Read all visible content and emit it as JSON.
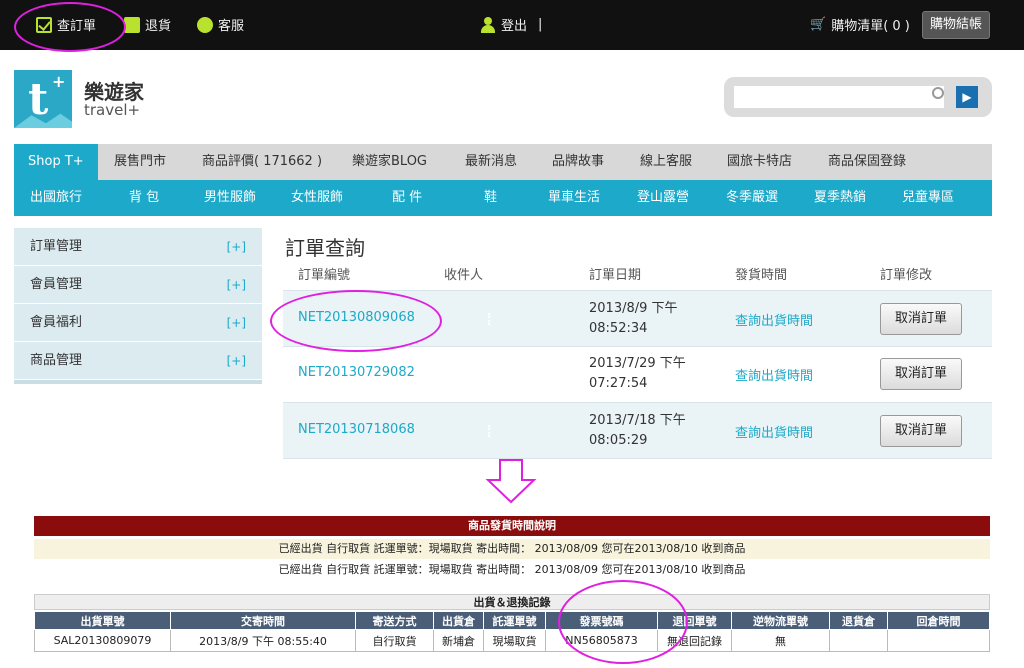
{
  "topbar": {
    "order_query": "查訂單",
    "return": "退貨",
    "service": "客服",
    "logout": "登出",
    "separator": "|",
    "cart": "購物清單( 0 )",
    "checkout": "購物結帳"
  },
  "brand": {
    "logo_letter": "t",
    "logo_plus": "+",
    "name_cn": "樂遊家",
    "name_en": "travel+"
  },
  "search": {
    "placeholder": "",
    "button": "▶"
  },
  "nav_primary": [
    "Shop T+",
    "展售門市",
    "商品評價( 171662 )",
    "樂遊家BLOG",
    "最新消息",
    "品牌故事",
    "線上客服",
    "國旅卡特店",
    "商品保固登錄"
  ],
  "nav_secondary": [
    "出國旅行",
    "背 包",
    "男性服飾",
    "女性服飾",
    "配 件",
    "鞋",
    "單車生活",
    "登山露營",
    "冬季嚴選",
    "夏季熱銷",
    "兒童專區"
  ],
  "sidebar": {
    "items": [
      {
        "label": "訂單管理",
        "toggle": "[+]"
      },
      {
        "label": "會員管理",
        "toggle": "[+]"
      },
      {
        "label": "會員福利",
        "toggle": "[+]"
      },
      {
        "label": "商品管理",
        "toggle": "[+]"
      }
    ]
  },
  "orders": {
    "title": "訂單查詢",
    "headers": [
      "訂單編號",
      "收件人",
      "訂單日期",
      "發貨時間",
      "訂單修改"
    ],
    "rows": [
      {
        "id": "NET20130809068",
        "date1": "2013/8/9 下午",
        "date2": "08:52:34",
        "ship": "查詢出貨時間",
        "action": "取消訂單"
      },
      {
        "id": "NET20130729082",
        "date1": "2013/7/29 下午",
        "date2": "07:27:54",
        "ship": "查詢出貨時間",
        "action": "取消訂單"
      },
      {
        "id": "NET20130718068",
        "date1": "2013/7/18 下午",
        "date2": "08:05:29",
        "ship": "查詢出貨時間",
        "action": "取消訂單"
      }
    ]
  },
  "shipping_info": {
    "title": "商品發貨時間說明",
    "line1": "已經出貨 自行取貨 託運單號：現場取貨 寄出時間： 2013/08/09 您可在2013/08/10 收到商品",
    "line2": "已經出貨 自行取貨 託運單號：現場取貨 寄出時間： 2013/08/09 您可在2013/08/10 收到商品",
    "record_title": "出貨＆退換記錄",
    "columns": [
      "出貨單號",
      "交寄時間",
      "寄送方式",
      "出貨倉",
      "託運單號",
      "發票號碼",
      "退回單號",
      "逆物流單號",
      "退貨倉",
      "回倉時間"
    ],
    "row": [
      "SAL20130809079",
      "2013/8/9 下午 08:55:40",
      "自行取貨",
      "新埔倉",
      "現場取貨",
      "NN56805873",
      "無退回記錄",
      "無",
      "",
      ""
    ]
  },
  "colors": {
    "accent": "#1da9c9",
    "topbar": "#111111",
    "annotation": "#e020e0",
    "info_header": "#8b0c0c",
    "table_header": "#4a5e78"
  }
}
